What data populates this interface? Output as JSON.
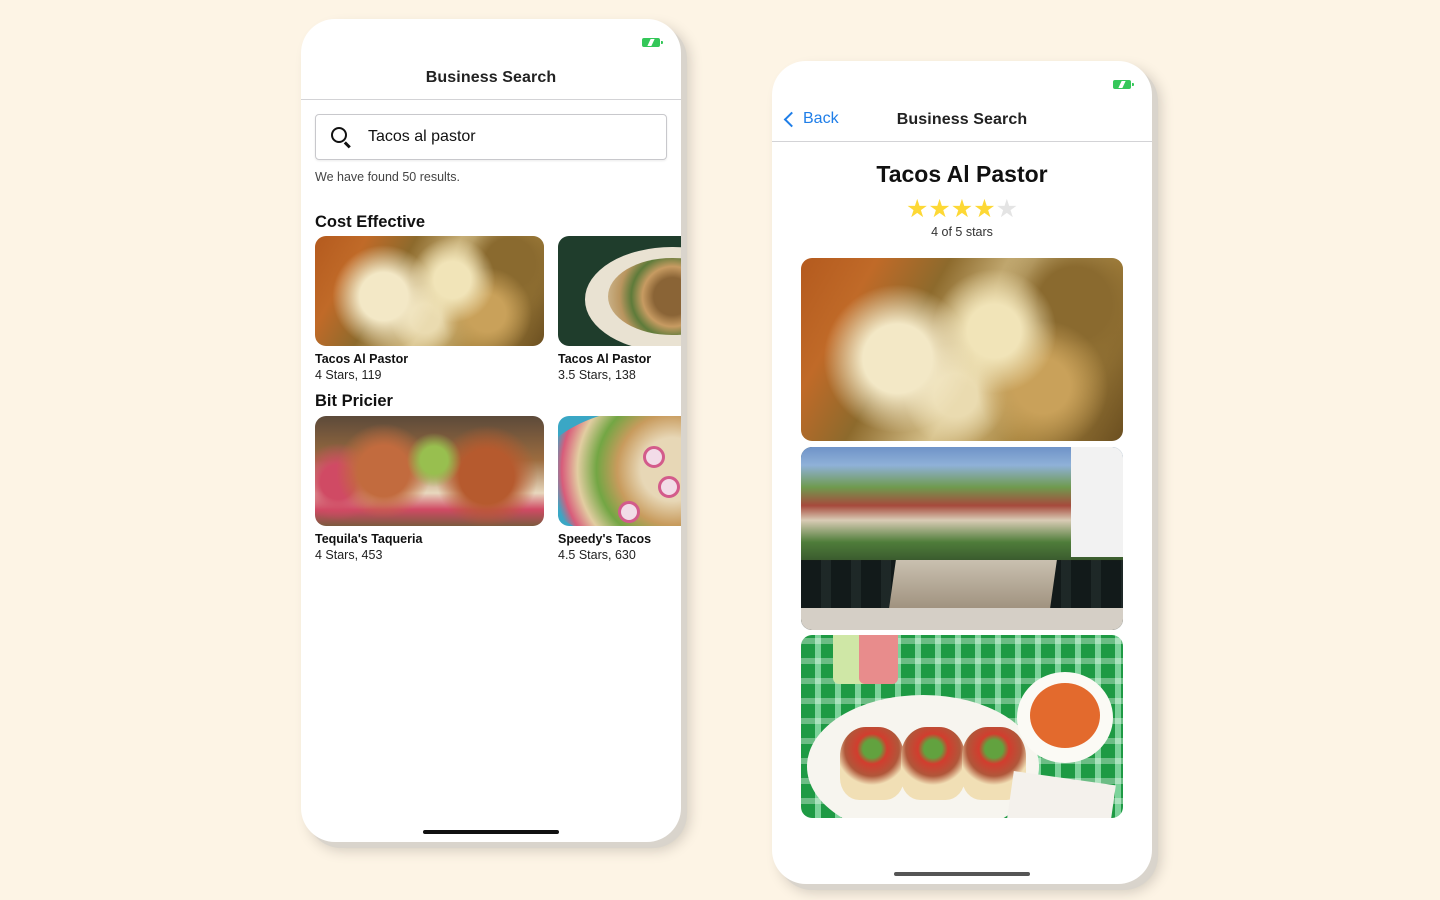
{
  "colors": {
    "background": "#fdf4e5",
    "accent": "#1f7ee8",
    "star": "#fdd835",
    "battery": "#34c759"
  },
  "left_screen": {
    "nav_title": "Business Search",
    "search": {
      "value": "Tacos al pastor",
      "icon": "search-icon"
    },
    "results_text": "We have found 50 results.",
    "sections": [
      {
        "title": "Cost Effective",
        "items": [
          {
            "name": "Tacos Al Pastor",
            "meta": "4 Stars, 119"
          },
          {
            "name": "Tacos Al Pastor",
            "meta": "3.5 Stars, 138"
          }
        ]
      },
      {
        "title": "Bit Pricier",
        "items": [
          {
            "name": "Tequila's Taqueria",
            "meta": "4 Stars, 453"
          },
          {
            "name": "Speedy's Tacos",
            "meta": "4.5 Stars, 630"
          }
        ]
      }
    ]
  },
  "right_screen": {
    "back_label": "Back",
    "nav_title": "Business Search",
    "business_name": "Tacos Al Pastor",
    "rating": {
      "value": 4,
      "max": 5,
      "text": "4 of 5 stars"
    }
  }
}
